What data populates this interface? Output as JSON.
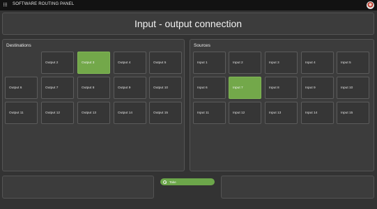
{
  "app": {
    "title": "SOFTWARE ROUTING PANEL"
  },
  "header": {
    "title": "Input - output connection"
  },
  "destinations": {
    "title": "Destinations",
    "selected": "Output 3",
    "items": [
      "Output 2",
      "Output 3",
      "Output 4",
      "Output 5",
      "Output 6",
      "Output 7",
      "Output 8",
      "Output 9",
      "Output 10",
      "Output 11",
      "Output 12",
      "Output 13",
      "Output 14",
      "Output 15"
    ]
  },
  "sources": {
    "title": "Sources",
    "selected": "Input 7",
    "items": [
      "Input 1",
      "Input 2",
      "Input 3",
      "Input 4",
      "Input 5",
      "Input 6",
      "Input 7",
      "Input 8",
      "Input 9",
      "Input 10",
      "Input 11",
      "Input 12",
      "Input 13",
      "Input 14",
      "Input 15"
    ]
  },
  "actions": {
    "take_label": "Take"
  },
  "colors": {
    "accent": "#73a84a",
    "background": "#333333",
    "panel": "#3c3c3c",
    "titlebar": "#121212"
  }
}
